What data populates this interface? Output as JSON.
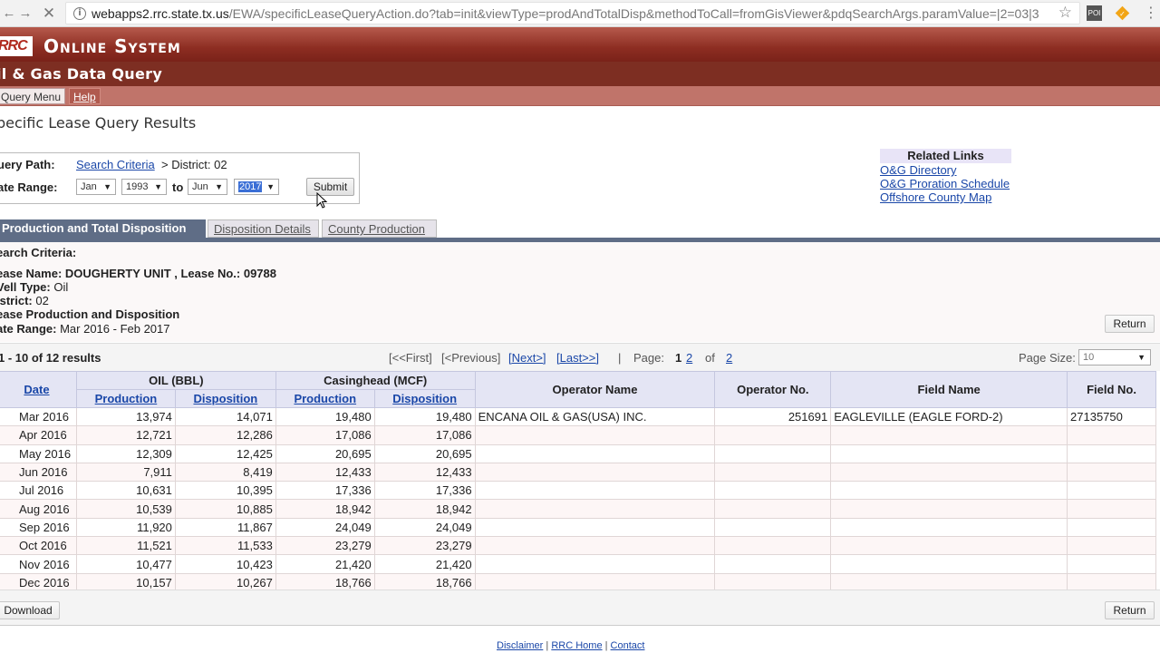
{
  "browser": {
    "url_host": "webapps2.rrc.state.tx.us",
    "url_path": "/EWA/specificLeaseQueryAction.do?tab=init&viewType=prodAndTotalDisp&methodToCall=fromGisViewer&pdqSearchArgs.paramValue=|2=03|3",
    "ext_label": "POI"
  },
  "header": {
    "logo": "RRC",
    "title": "Online System",
    "subtitle": "il & Gas Data Query"
  },
  "menu": {
    "query_menu": "Query Menu",
    "help": "Help"
  },
  "page_title": "pecific Lease Query Results",
  "query": {
    "path_label": "uery Path:",
    "path_link": "Search Criteria",
    "path_rest": "> District: 02",
    "range_label": "ate Range:",
    "from_month": "Jan",
    "from_year": "1993",
    "to_label": "to",
    "to_month": "Jun",
    "to_year": "2017",
    "submit": "Submit"
  },
  "related": {
    "heading": "Related Links",
    "links": [
      "O&G Directory",
      "O&G Proration Schedule",
      "Offshore County Map"
    ]
  },
  "tabs": [
    "Production and Total Disposition",
    "Disposition Details",
    "County Production"
  ],
  "criteria": {
    "heading": "earch Criteria:",
    "lease": "ease Name: DOUGHERTY UNIT , Lease No.: 09788",
    "well_type_label": "Vell Type:",
    "well_type": "Oil",
    "district_label": "istrict:",
    "district": "02",
    "lpd": "ease Production and Disposition",
    "date_range_label": "ate Range:",
    "date_range": "Mar 2016 - Feb 2017",
    "return": "Return"
  },
  "pager": {
    "count": "1 - 10 of 12 results",
    "first": "[<<First]",
    "prev": "[<Previous]",
    "next": "[Next>]",
    "last": "[Last>>]",
    "sep": "|",
    "page_label": "Page:",
    "page_current": "1",
    "page_other": "2",
    "of": "of",
    "total": "2",
    "size_label": "Page Size:",
    "size_value": "10"
  },
  "table": {
    "headers": {
      "date": "Date",
      "oil": "OIL (BBL)",
      "gas": "Casinghead (MCF)",
      "production": "Production",
      "disposition": "Disposition",
      "operator_name": "Operator Name",
      "operator_no": "Operator No.",
      "field_name": "Field Name",
      "field_no": "Field No."
    },
    "rows": [
      {
        "date": "Mar 2016",
        "oil_prod": "13,974",
        "oil_disp": "14,071",
        "gas_prod": "19,480",
        "gas_disp": "19,480",
        "op_name": "ENCANA OIL & GAS(USA) INC.",
        "op_no": "251691",
        "field_name": "EAGLEVILLE (EAGLE FORD-2)",
        "field_no": "27135750"
      },
      {
        "date": "Apr 2016",
        "oil_prod": "12,721",
        "oil_disp": "12,286",
        "gas_prod": "17,086",
        "gas_disp": "17,086",
        "op_name": "",
        "op_no": "",
        "field_name": "",
        "field_no": ""
      },
      {
        "date": "May 2016",
        "oil_prod": "12,309",
        "oil_disp": "12,425",
        "gas_prod": "20,695",
        "gas_disp": "20,695",
        "op_name": "",
        "op_no": "",
        "field_name": "",
        "field_no": ""
      },
      {
        "date": "Jun 2016",
        "oil_prod": "7,911",
        "oil_disp": "8,419",
        "gas_prod": "12,433",
        "gas_disp": "12,433",
        "op_name": "",
        "op_no": "",
        "field_name": "",
        "field_no": ""
      },
      {
        "date": "Jul 2016",
        "oil_prod": "10,631",
        "oil_disp": "10,395",
        "gas_prod": "17,336",
        "gas_disp": "17,336",
        "op_name": "",
        "op_no": "",
        "field_name": "",
        "field_no": ""
      },
      {
        "date": "Aug 2016",
        "oil_prod": "10,539",
        "oil_disp": "10,885",
        "gas_prod": "18,942",
        "gas_disp": "18,942",
        "op_name": "",
        "op_no": "",
        "field_name": "",
        "field_no": ""
      },
      {
        "date": "Sep 2016",
        "oil_prod": "11,920",
        "oil_disp": "11,867",
        "gas_prod": "24,049",
        "gas_disp": "24,049",
        "op_name": "",
        "op_no": "",
        "field_name": "",
        "field_no": ""
      },
      {
        "date": "Oct 2016",
        "oil_prod": "11,521",
        "oil_disp": "11,533",
        "gas_prod": "23,279",
        "gas_disp": "23,279",
        "op_name": "",
        "op_no": "",
        "field_name": "",
        "field_no": ""
      },
      {
        "date": "Nov 2016",
        "oil_prod": "10,477",
        "oil_disp": "10,423",
        "gas_prod": "21,420",
        "gas_disp": "21,420",
        "op_name": "",
        "op_no": "",
        "field_name": "",
        "field_no": ""
      },
      {
        "date": "Dec 2016",
        "oil_prod": "10,157",
        "oil_disp": "10,267",
        "gas_prod": "18,766",
        "gas_disp": "18,766",
        "op_name": "",
        "op_no": "",
        "field_name": "",
        "field_no": ""
      }
    ]
  },
  "footer": {
    "download": "Download",
    "return": "Return",
    "disclaimer": "Disclaimer",
    "rrc_home": "RRC Home",
    "contact": "Contact",
    "sep": "|"
  }
}
